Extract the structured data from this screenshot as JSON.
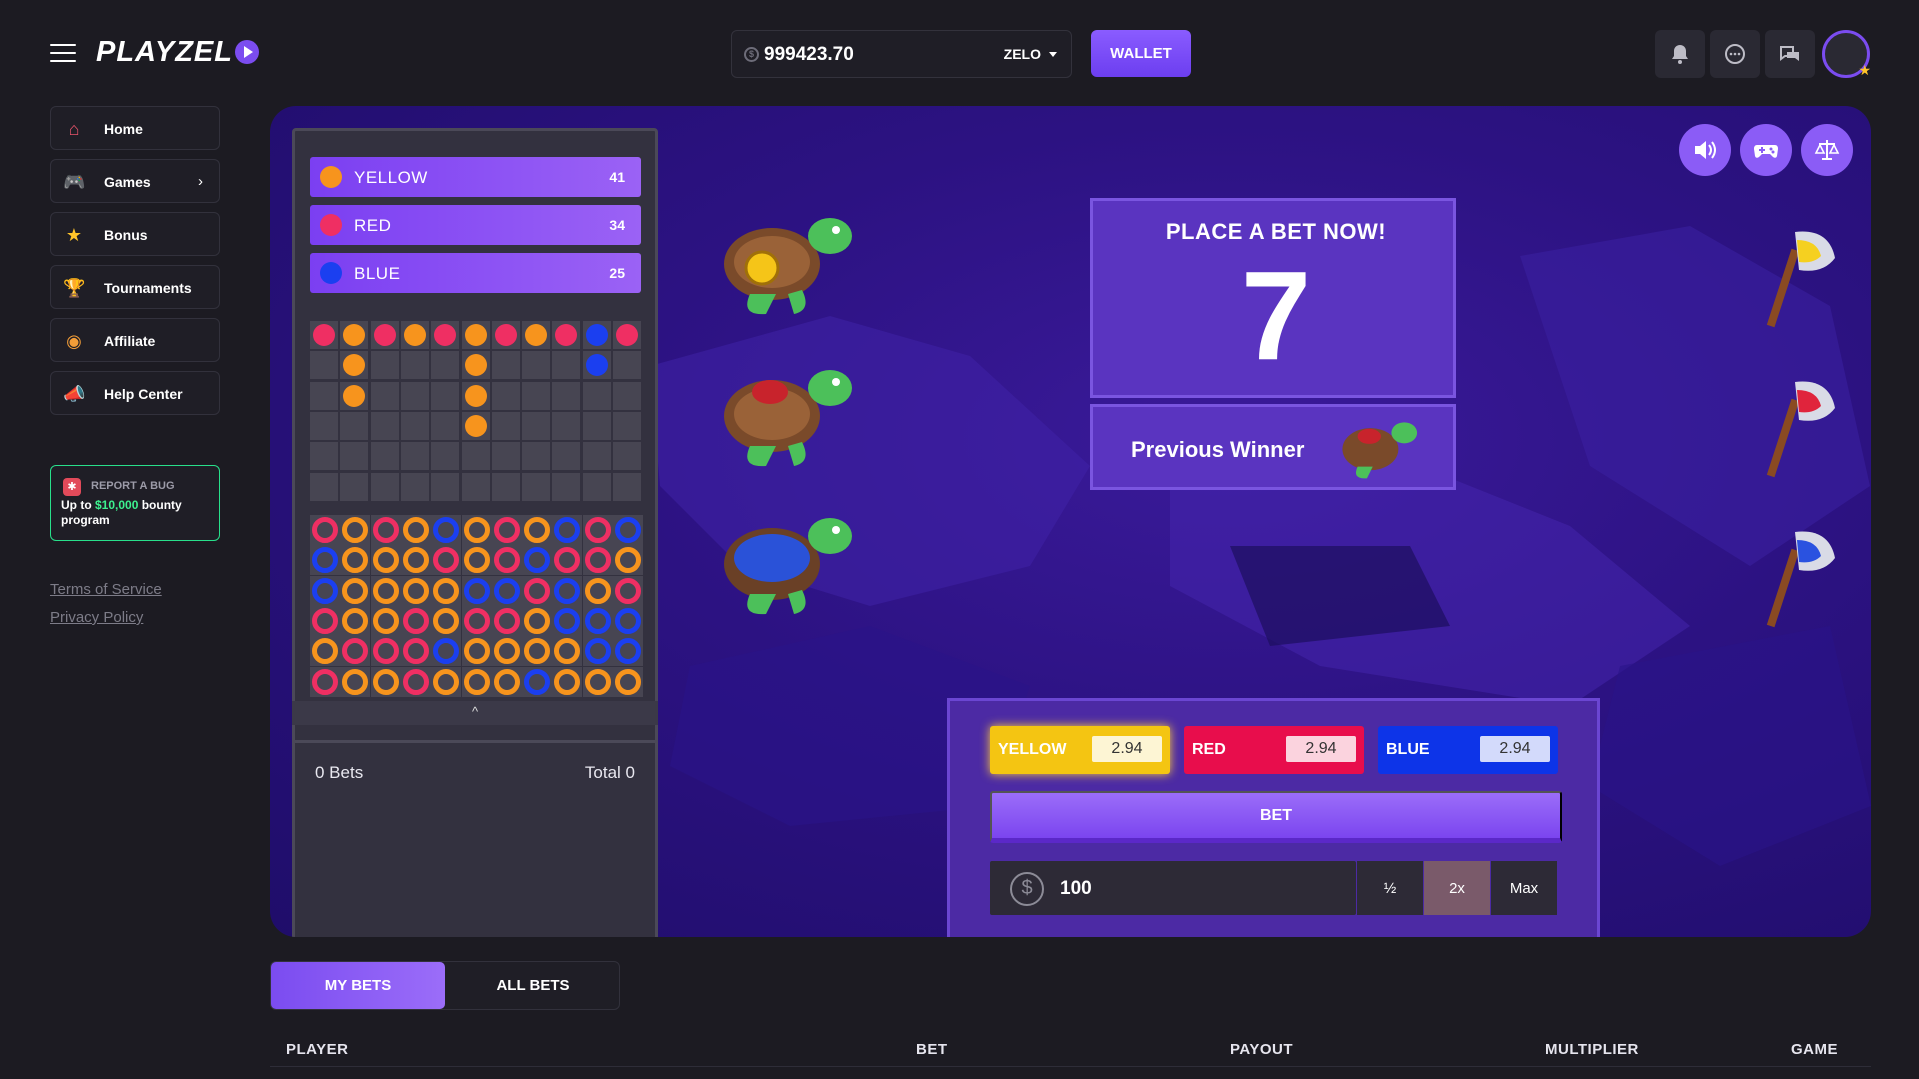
{
  "header": {
    "logo": "PLAYZEL",
    "balance": "999423.70",
    "coin_glyph": "$",
    "currency": "ZELO",
    "wallet_label": "WALLET",
    "icons": [
      "bell-icon",
      "chat-icon",
      "community-chat-icon"
    ]
  },
  "sidebar": {
    "items": [
      {
        "label": "Home",
        "icon": "house-icon"
      },
      {
        "label": "Games",
        "icon": "gamepad-icon"
      },
      {
        "label": "Bonus",
        "icon": "star-icon"
      },
      {
        "label": "Tournaments",
        "icon": "trophy-icon"
      },
      {
        "label": "Affiliate",
        "icon": "coin-icon"
      },
      {
        "label": "Help Center",
        "icon": "megaphone-icon"
      }
    ],
    "bug": {
      "title": "REPORT A BUG",
      "text_prefix": "Up to ",
      "amount": "$10,000",
      "text_suffix": " bounty program"
    },
    "terms": "Terms of Service",
    "privacy": "Privacy Policy"
  },
  "game": {
    "counts": [
      {
        "name": "YELLOW",
        "value": "41",
        "color": "#f7941d"
      },
      {
        "name": "RED",
        "value": "34",
        "color": "#ef2f63"
      },
      {
        "name": "BLUE",
        "value": "25",
        "color": "#1b3ff0"
      }
    ],
    "history_columns": [
      [
        "R"
      ],
      [
        "Y",
        "Y",
        "Y"
      ],
      [
        "R"
      ],
      [
        "Y"
      ],
      [
        "R"
      ],
      [
        "Y",
        "Y",
        "Y",
        "Y"
      ],
      [
        "R"
      ],
      [
        "Y"
      ],
      [
        "R"
      ],
      [
        "B",
        "B"
      ],
      [
        "R"
      ]
    ],
    "ring_rows": [
      [
        "R",
        "Y",
        "R",
        "Y",
        "B",
        "Y",
        "R",
        "Y",
        "B",
        "R",
        "B"
      ],
      [
        "B",
        "Y",
        "Y",
        "Y",
        "R",
        "Y",
        "R",
        "B",
        "R",
        "R",
        "Y"
      ],
      [
        "B",
        "Y",
        "Y",
        "Y",
        "Y",
        "B",
        "B",
        "R",
        "B",
        "Y",
        "R"
      ],
      [
        "R",
        "Y",
        "Y",
        "R",
        "Y",
        "R",
        "R",
        "Y",
        "B",
        "B",
        "B"
      ],
      [
        "Y",
        "R",
        "R",
        "R",
        "B",
        "Y",
        "Y",
        "Y",
        "Y",
        "B",
        "B"
      ],
      [
        "R",
        "Y",
        "Y",
        "R",
        "Y",
        "Y",
        "Y",
        "B",
        "Y",
        "Y",
        "Y"
      ]
    ],
    "collapse_glyph": "^",
    "bets_count": "0 Bets",
    "bets_total": "Total 0",
    "board_title": "PLACE A BET NOW!",
    "countdown": "7",
    "previous_winner_label": "Previous Winner",
    "odds": [
      {
        "name": "YELLOW",
        "value": "2.94"
      },
      {
        "name": "RED",
        "value": "2.94"
      },
      {
        "name": "BLUE",
        "value": "2.94"
      }
    ],
    "bet_label": "BET",
    "amount_symbol": "$",
    "amount": "100",
    "half_label": "½",
    "double_label": "2x",
    "max_label": "Max"
  },
  "bets_table": {
    "tabs": [
      "MY BETS",
      "ALL BETS"
    ],
    "columns": [
      "PLAYER",
      "BET",
      "PAYOUT",
      "MULTIPLIER",
      "GAME"
    ]
  },
  "colors": {
    "accent": "#7b4cf0",
    "yellow": "#f7941d",
    "red": "#ef2f63",
    "blue": "#1b3ff0"
  }
}
